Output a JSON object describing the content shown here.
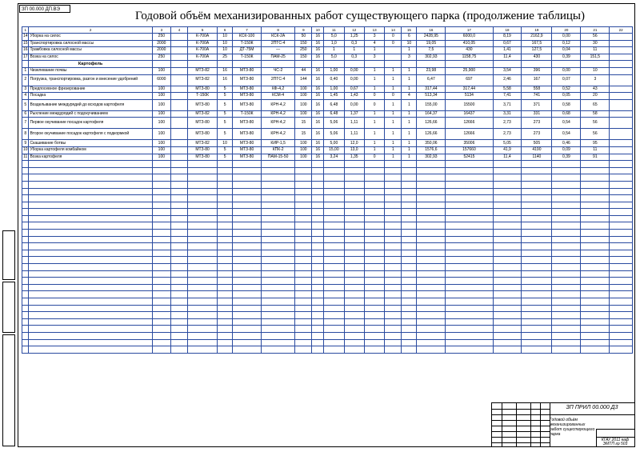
{
  "sheet": {
    "stamp_code": "ЗП 00.000 ДП.ВЭ",
    "title": "Годовой объём механизированных работ существующего парка (продолжение таблицы)"
  },
  "table": {
    "column_numbers": [
      "1",
      "2",
      "3",
      "4",
      "5",
      "6",
      "7",
      "8",
      "9",
      "10",
      "11",
      "12",
      "13",
      "14",
      "15",
      "16",
      "17",
      "18",
      "19",
      "20",
      "21",
      "22"
    ],
    "rows": [
      {
        "type": "data",
        "cells": [
          "14",
          "Уборка на силос",
          "250",
          "",
          "К-700А",
          "10",
          "КСК-100",
          "КСК-2А",
          "50",
          "16",
          "5,0",
          "1,25",
          "3",
          "0",
          "6",
          "2428,95",
          "6000,0",
          "8,19",
          "2162,9",
          "0,00",
          "56"
        ]
      },
      {
        "type": "data",
        "cells": [
          "15",
          "Транспортировка силосной массы",
          "2000",
          "",
          "К-700А",
          "10",
          "Т-150К",
          "2ПТС-4",
          "150",
          "16",
          "1,0",
          "0,3",
          "4",
          "0",
          "10",
          "19,05",
          "410,05",
          "0,67",
          "167,5",
          "0,12",
          "30"
        ]
      },
      {
        "type": "data",
        "cells": [
          "16",
          "Трамбовка силосной массы",
          "2000",
          "",
          "К-700А",
          "10",
          "ДТ-75М",
          "—",
          "250",
          "16",
          "1",
          "1",
          "1",
          "",
          "1",
          "7,5",
          "430",
          "1,41",
          "127,5",
          "0,04",
          "11"
        ]
      },
      {
        "type": "data",
        "cells": [
          "17",
          "Возка на силос",
          "250",
          "",
          "К-700А",
          "25",
          "Т-150К",
          "ПАМ-25",
          "150",
          "16",
          "5,0",
          "0,3",
          "3",
          "",
          "3",
          "302,93",
          "1158,75",
          "11,4",
          "430",
          "0,39",
          "151,5"
        ]
      },
      {
        "type": "section",
        "label": "Картофель"
      },
      {
        "type": "data",
        "cells": [
          "1",
          "Чизелевание почвы",
          "100",
          "",
          "МТЗ-82",
          "16",
          "МТЗ-80",
          "ЧС-2",
          "44",
          "16",
          "1,00",
          "0,00",
          "1",
          "1",
          "1",
          "23,98",
          "25,900",
          "3,54",
          "396",
          "0,00",
          "10"
        ]
      },
      {
        "type": "tall",
        "cells": [
          "2",
          "Погрузка, транспортировка, разгон и внесение удобрений",
          "6000",
          "",
          "МТЗ-82",
          "16",
          "МТЗ-80",
          "2ПТС-4",
          "144",
          "16",
          "0,40",
          "0,00",
          "1",
          "1",
          "1",
          "6,47",
          "697",
          "2,46",
          "167",
          "0,07",
          "3"
        ]
      },
      {
        "type": "data",
        "cells": [
          "3",
          "Предпосевное фрезерование",
          "100",
          "",
          "МТЗ-80",
          "5",
          "МТЗ-80",
          "КФ-4,2",
          "100",
          "16",
          "1,00",
          "0,67",
          "1",
          "1",
          "1",
          "317,44",
          "317,44",
          "5,58",
          "558",
          "0,52",
          "43"
        ]
      },
      {
        "type": "data",
        "cells": [
          "4",
          "Посадка",
          "100",
          "",
          "Т-150К",
          "5",
          "МТЗ-80",
          "КСМ-4",
          "100",
          "16",
          "1,45",
          "1,43",
          "0",
          "0",
          "4",
          "513,34",
          "5134",
          "7,41",
          "741",
          "0,05",
          "20"
        ]
      },
      {
        "type": "tall",
        "cells": [
          "5",
          "Возделывание междурядий до всходов картофеля",
          "100",
          "",
          "МТЗ-80",
          "5",
          "МТЗ-80",
          "КРН-4,2",
          "100",
          "16",
          "6,48",
          "0,00",
          "0",
          "1",
          "1",
          "155,00",
          "15500",
          "3,71",
          "371",
          "0,58",
          "65"
        ]
      },
      {
        "type": "data",
        "cells": [
          "6",
          "Рыхление междурядий с подокучиванием",
          "100",
          "",
          "МТЗ-82",
          "5",
          "Т-150К",
          "КРН-4,2",
          "100",
          "16",
          "6,48",
          "1,37",
          "1",
          "1",
          "1",
          "164,37",
          "16437",
          "3,31",
          "331",
          "0,68",
          "58"
        ]
      },
      {
        "type": "tall",
        "cells": [
          "7",
          "Первое окучивание посадок картофеля",
          "100",
          "",
          "МТЗ-80",
          "5",
          "МТЗ-80",
          "КРН-4,2",
          "15",
          "16",
          "5,06",
          "1,11",
          "1",
          "1",
          "1",
          "126,66",
          "12666",
          "2,73",
          "273",
          "0,54",
          "56"
        ]
      },
      {
        "type": "tall",
        "cells": [
          "8",
          "Второе окучивание посадок картофеля с подкормкой",
          "100",
          "",
          "МТЗ-80",
          "5",
          "МТЗ-80",
          "КРН-4,2",
          "15",
          "16",
          "5,06",
          "1,11",
          "1",
          "1",
          "1",
          "126,66",
          "12666",
          "2,73",
          "273",
          "0,54",
          "56"
        ]
      },
      {
        "type": "data",
        "cells": [
          "9",
          "Скашивание ботвы",
          "100",
          "",
          "МТЗ-82",
          "10",
          "МТЗ-80",
          "КИР-1,5",
          "100",
          "16",
          "5,00",
          "12,0",
          "1",
          "1",
          "1",
          "350,06",
          "35006",
          "5,05",
          "505",
          "0,46",
          "95"
        ]
      },
      {
        "type": "data",
        "cells": [
          "10",
          "Уборка картофеля комбайном",
          "100",
          "",
          "МТЗ-80",
          "5",
          "МТЗ-80",
          "КПК-2",
          "100",
          "16",
          "15,00",
          "13,0",
          "1",
          "1",
          "1",
          "1576,6",
          "157660",
          "41,9",
          "4190",
          "0,09",
          "11"
        ]
      },
      {
        "type": "data",
        "cells": [
          "11",
          "Возка картофеля",
          "100",
          "",
          "МТЗ-80",
          "5",
          "МТЗ-80",
          "ПАМ-15-50",
          "100",
          "16",
          "3,24",
          "1,35",
          "0",
          "1",
          "1",
          "302,93",
          "52415",
          "11,4",
          "1140",
          "0,39",
          "91"
        ]
      }
    ]
  },
  "title_block": {
    "code": "ЗП ПРИЛ 00.000 Д3",
    "name": "Годовой объём механизированных работ существующего парка",
    "org": "КГАУ 2011 каф ЭМТП гр 503"
  }
}
